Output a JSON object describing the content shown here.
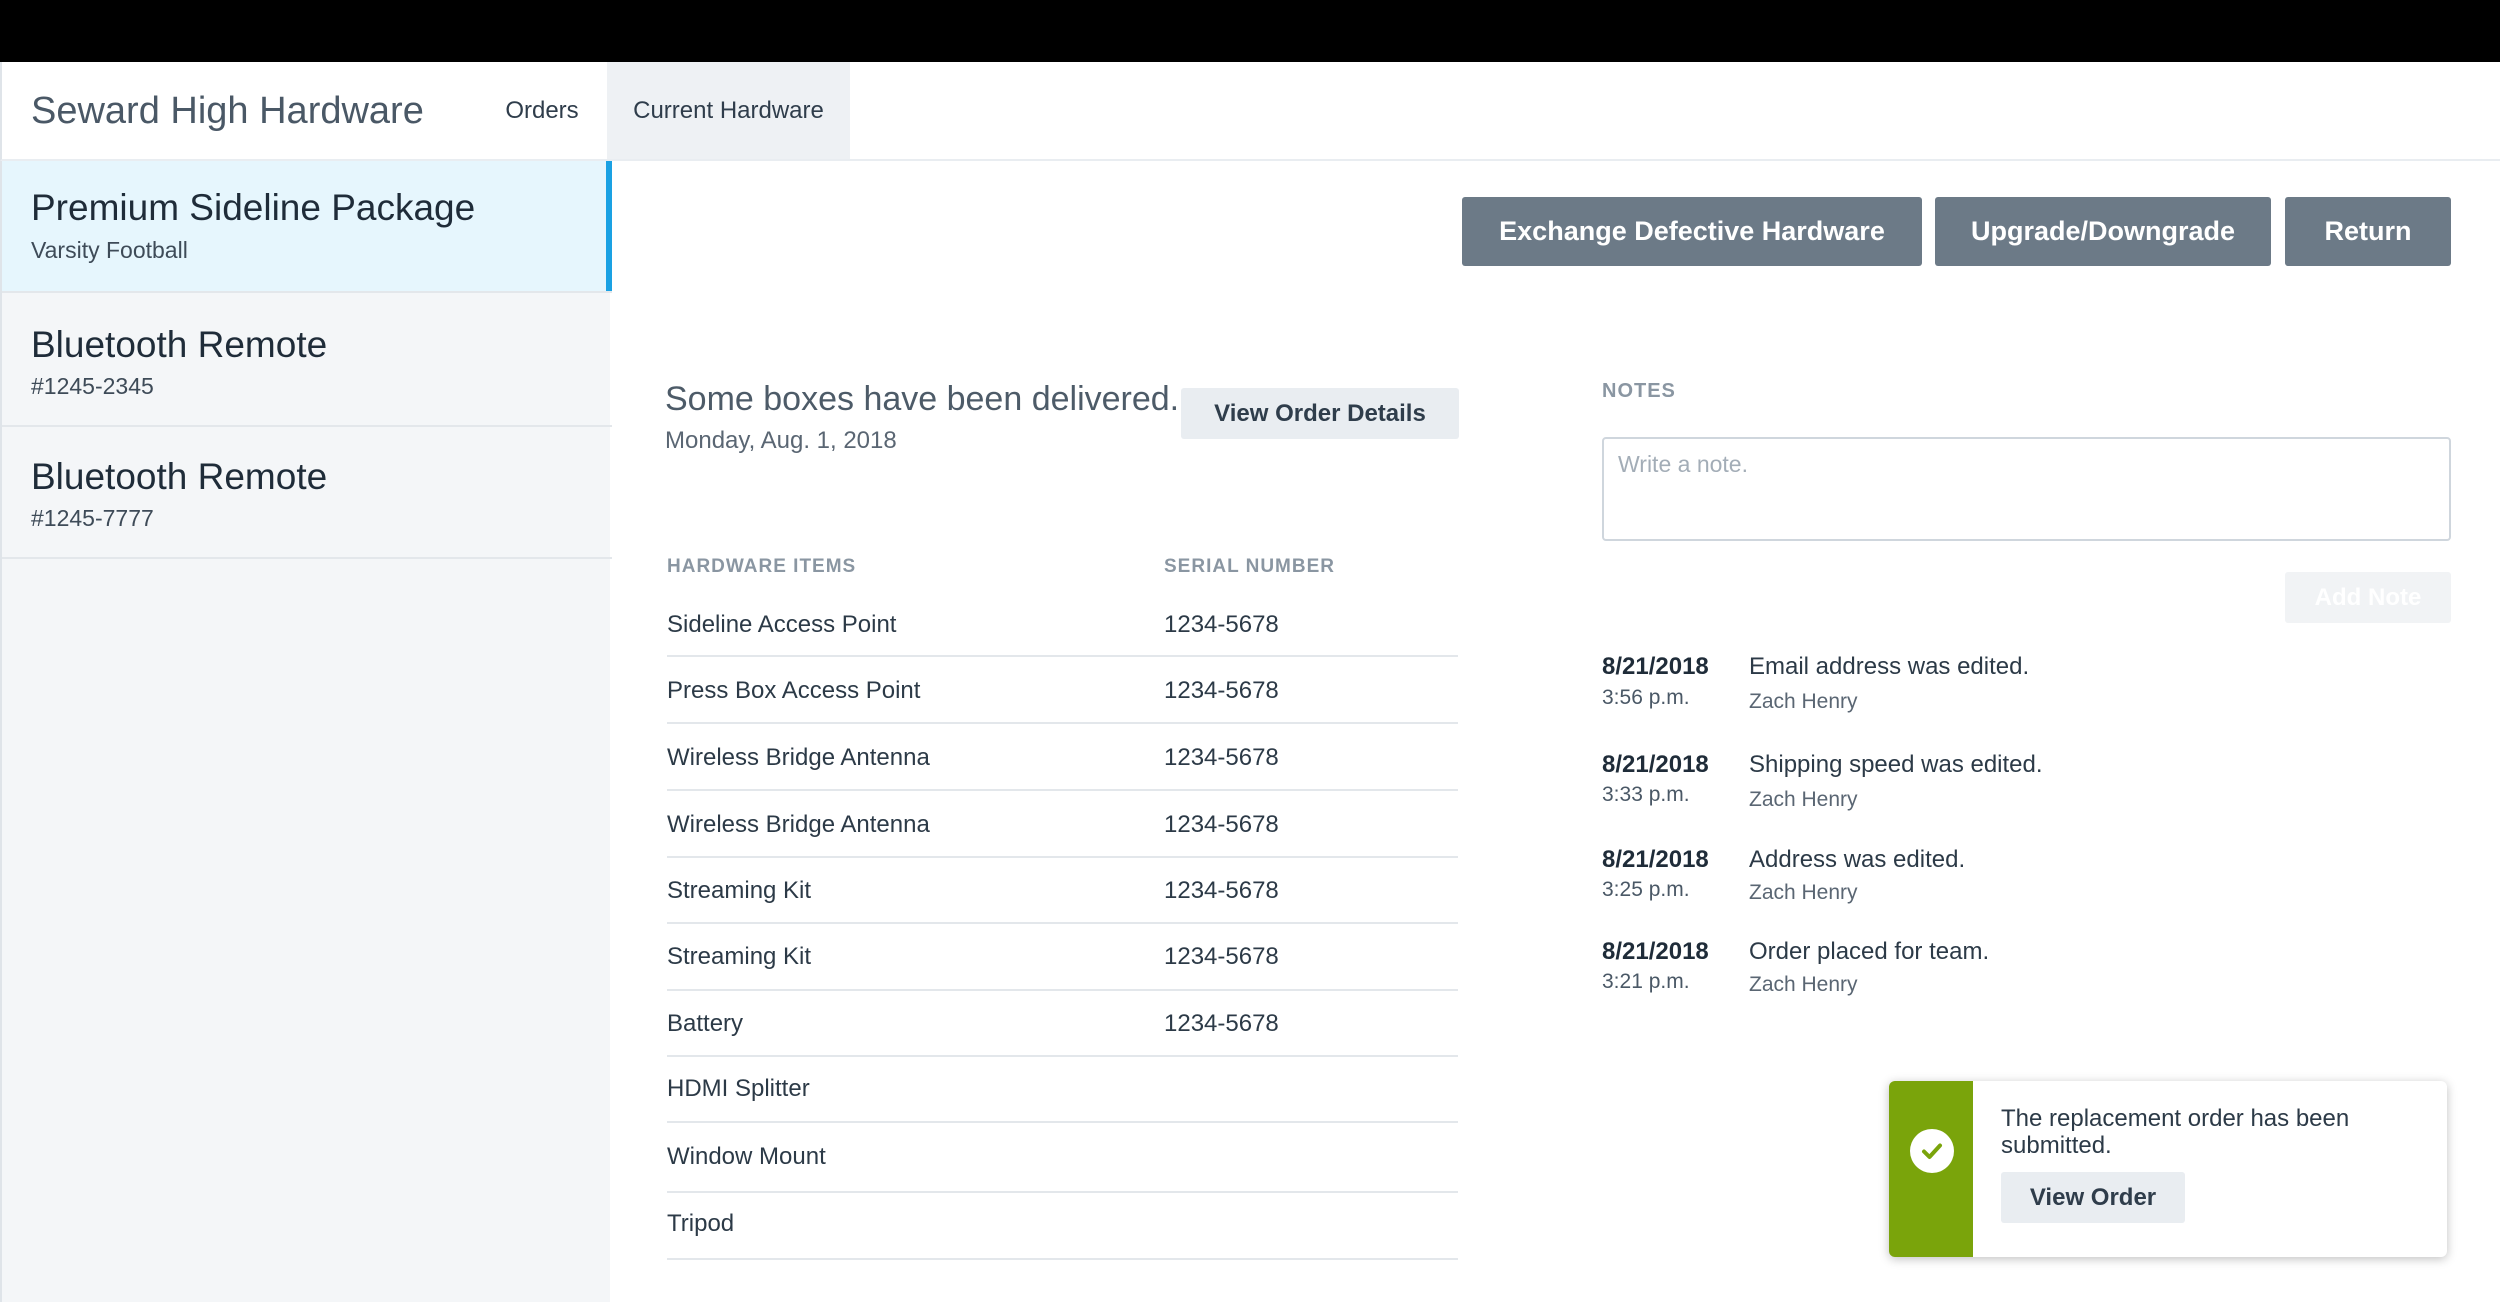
{
  "header": {
    "app_title": "Seward High Hardware",
    "tabs": [
      {
        "label": "Orders",
        "active": false
      },
      {
        "label": "Current Hardware",
        "active": true
      }
    ]
  },
  "sidebar": {
    "items": [
      {
        "title": "Premium Sideline Package",
        "subtitle": "Varsity Football",
        "active": true
      },
      {
        "title": "Bluetooth Remote",
        "subtitle": "#1245-2345",
        "active": false
      },
      {
        "title": "Bluetooth Remote",
        "subtitle": "#1245-7777",
        "active": false
      }
    ]
  },
  "actions": {
    "exchange": "Exchange Defective Hardware",
    "upgrade": "Upgrade/Downgrade",
    "return": "Return"
  },
  "delivery": {
    "message": "Some boxes have been delivered.",
    "date": "Monday, Aug. 1, 2018",
    "view_order_details": "View Order Details"
  },
  "hardware_table": {
    "columns": [
      "HARDWARE ITEMS",
      "SERIAL NUMBER"
    ],
    "rows": [
      {
        "name": "Sideline Access Point",
        "serial": "1234-5678"
      },
      {
        "name": "Press Box Access Point",
        "serial": "1234-5678"
      },
      {
        "name": "Wireless Bridge Antenna",
        "serial": "1234-5678"
      },
      {
        "name": "Wireless Bridge Antenna",
        "serial": "1234-5678"
      },
      {
        "name": "Streaming Kit",
        "serial": "1234-5678"
      },
      {
        "name": "Streaming Kit",
        "serial": "1234-5678"
      },
      {
        "name": "Battery",
        "serial": "1234-5678"
      },
      {
        "name": "HDMI Splitter",
        "serial": ""
      },
      {
        "name": "Window Mount",
        "serial": ""
      },
      {
        "name": "Tripod",
        "serial": ""
      }
    ]
  },
  "notes": {
    "label": "NOTES",
    "placeholder": "Write a note.",
    "value": "",
    "add_button": "Add Note"
  },
  "activity": [
    {
      "date": "8/21/2018",
      "time": "3:56 p.m.",
      "text": "Email address was edited.",
      "user": "Zach Henry"
    },
    {
      "date": "8/21/2018",
      "time": "3:33 p.m.",
      "text": "Shipping speed was edited.",
      "user": "Zach Henry"
    },
    {
      "date": "8/21/2018",
      "time": "3:25 p.m.",
      "text": "Address was edited.",
      "user": "Zach Henry"
    },
    {
      "date": "8/21/2018",
      "time": "3:21 p.m.",
      "text": "Order placed for team.",
      "user": "Zach Henry"
    }
  ],
  "toast": {
    "message": "The replacement order has been submitted.",
    "button": "View Order",
    "icon": "check-circle-icon"
  },
  "colors": {
    "accent": "#1aa1e3",
    "active_item_bg": "#e6f6fd",
    "action_button": "#6c7a87",
    "success": "#7aa40b"
  }
}
